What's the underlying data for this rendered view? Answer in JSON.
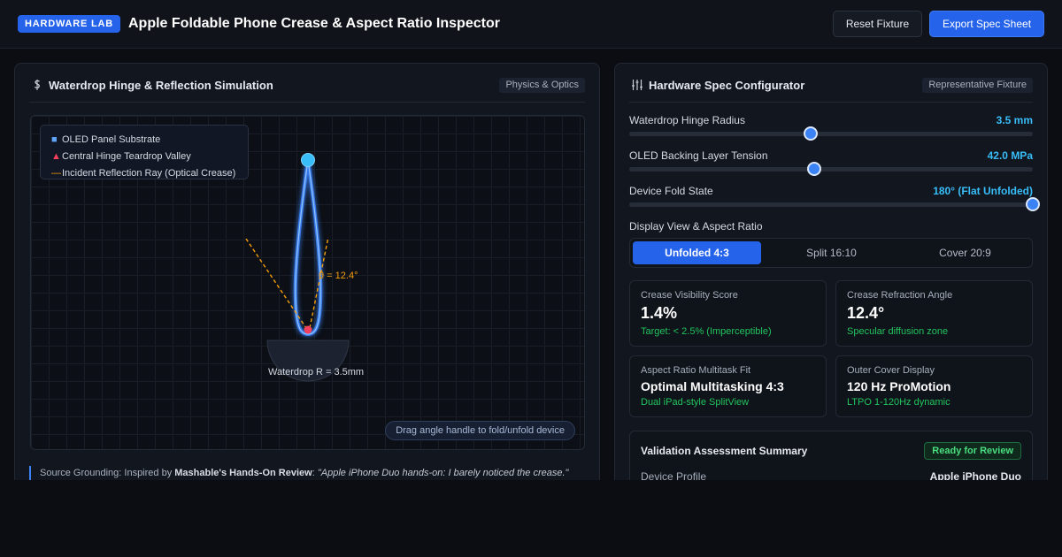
{
  "header": {
    "badge": "HARDWARE LAB",
    "title": "Apple Foldable Phone Crease & Aspect Ratio Inspector",
    "reset_label": "Reset Fixture",
    "export_label": "Export Spec Sheet"
  },
  "simulation": {
    "title": "Waterdrop Hinge & Reflection Simulation",
    "tag": "Physics & Optics",
    "legend": {
      "substrate": "OLED Panel Substrate",
      "valley": "Central Hinge Teardrop Valley",
      "ray": "Incident Reflection Ray (Optical Crease)"
    },
    "angle_label": "θ = 12.4°",
    "radius_label": "Waterdrop R = 3.5mm",
    "drag_hint": "Drag angle handle to fold/unfold device",
    "colors": {
      "substrate": "#60a5fa",
      "valley": "#f43f5e",
      "ray": "#f59e0b"
    }
  },
  "source": {
    "prefix": "Source Grounding: Inspired by ",
    "outlet": "Mashable's Hands-On Review",
    "sep": ": ",
    "quote": "\"Apple iPhone Duo hands-on: I barely noticed the crease.\""
  },
  "config": {
    "title": "Hardware Spec Configurator",
    "tag": "Representative Fixture",
    "sliders": [
      {
        "label": "Waterdrop Hinge Radius",
        "value": "3.5 mm",
        "fraction": 0.45
      },
      {
        "label": "OLED Backing Layer Tension",
        "value": "42.0 MPa",
        "fraction": 0.458
      },
      {
        "label": "Device Fold State",
        "value": "180° (Flat Unfolded)",
        "fraction": 1.0
      }
    ],
    "view_label": "Display View & Aspect Ratio",
    "views": [
      "Unfolded 4:3",
      "Split 16:10",
      "Cover 20:9"
    ],
    "active_view": "Unfolded 4:3",
    "cards": [
      {
        "label": "Crease Visibility Score",
        "value": "1.4%",
        "sub": "Target: < 2.5% (Imperceptible)"
      },
      {
        "label": "Crease Refraction Angle",
        "value": "12.4°",
        "sub": "Specular diffusion zone"
      },
      {
        "label": "Aspect Ratio Multitask Fit",
        "value": "Optimal Multitasking 4:3",
        "sub": "Dual iPad-style SplitView"
      },
      {
        "label": "Outer Cover Display",
        "value": "120 Hz ProMotion",
        "sub": "LTPO 1-120Hz dynamic"
      }
    ],
    "validation": {
      "title": "Validation Assessment Summary",
      "badge": "Ready for Review",
      "rows": [
        {
          "label": "Device Profile",
          "value": "Apple iPhone Duo"
        }
      ]
    }
  }
}
